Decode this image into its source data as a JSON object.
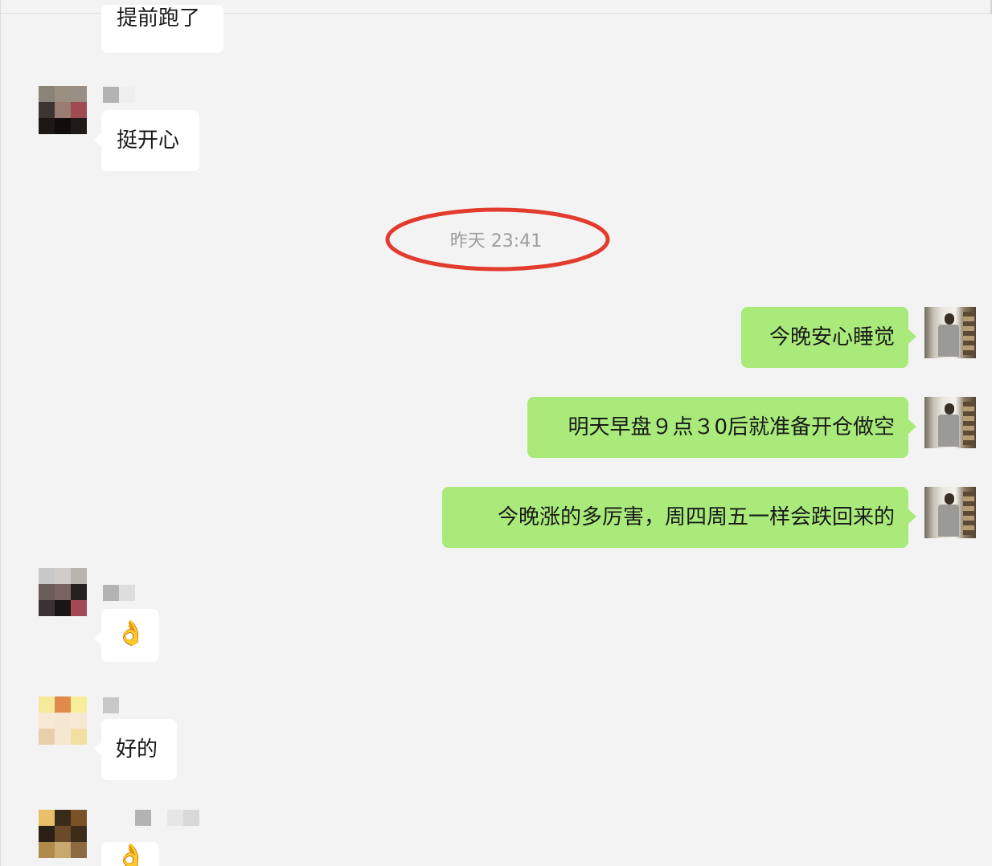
{
  "chat": {
    "messages": [
      {
        "text": "提前跑了"
      },
      {
        "text": "挺开心"
      },
      {
        "text": "今晚安心睡觉"
      },
      {
        "text": "明天早盘９点３0后就准备开仓做空"
      },
      {
        "text": "今晚涨的多厉害，周四周五一样会跌回来的"
      },
      {
        "text": "👌",
        "icon": "ok-hand-icon"
      },
      {
        "text": "好的"
      },
      {
        "text": "👌",
        "icon": "ok-hand-icon"
      }
    ],
    "timestamp": "昨天 23:41"
  },
  "colors": {
    "background": "#f3f3f3",
    "incoming_bubble": "#ffffff",
    "outgoing_bubble": "#a9ea7a",
    "highlight_ring": "#e33b2e",
    "timestamp_text": "#9c9c9c"
  }
}
